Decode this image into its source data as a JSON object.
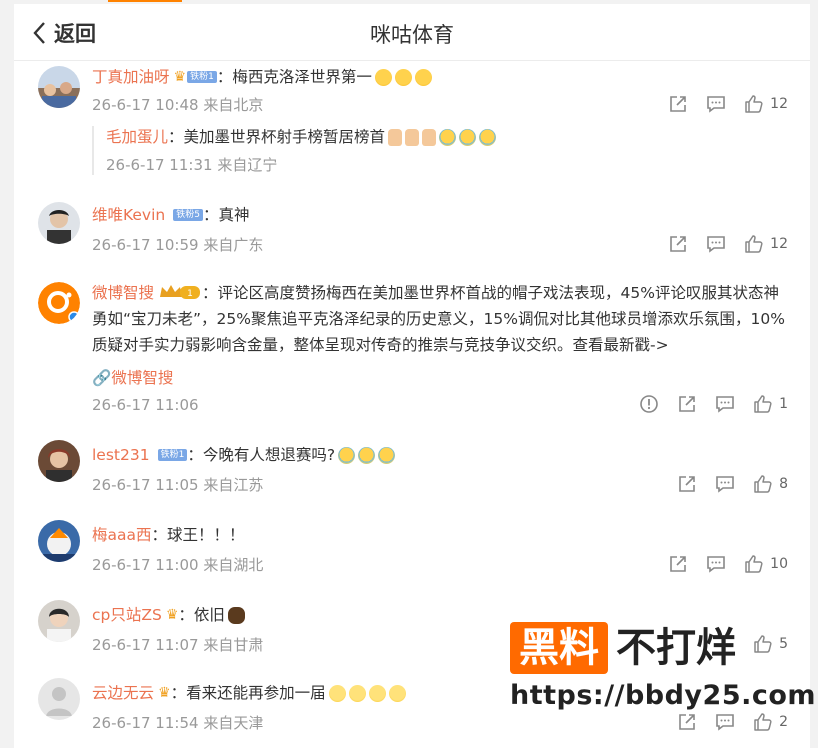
{
  "header": {
    "back_label": "返回",
    "title": "咪咕体育"
  },
  "comments": [
    {
      "user": "丁真加油呀",
      "fan_badge": "铁粉1",
      "text": "梅西克洛泽世界第一",
      "time": "26-6-17 10:48",
      "location": "来自北京",
      "likes": "12",
      "reply": {
        "user": "毛加蛋儿",
        "text": "美加墨世界杯射手榜暂居榜首",
        "time": "26-6-17 11:31",
        "location": "来自辽宁"
      }
    },
    {
      "user": "维唯Kevin",
      "fan_badge": "铁粉5",
      "text": "真神",
      "time": "26-6-17 10:59",
      "location": "来自广东",
      "likes": "12"
    },
    {
      "user": "微博智搜",
      "vip_level": "1",
      "text": "评论区高度赞扬梅西在美加墨世界杯首战的帽子戏法表现，45%评论叹服其状态神勇如“宝刀未老”，25%聚焦追平克洛泽纪录的历史意义，15%调侃对比其他球员增添欢乐氛围，10%质疑对手实力弱影响含金量，整体呈现对传奇的推崇与竞技争议交织。查看最新戳->",
      "link_label": "微博智搜",
      "time": "26-6-17 11:06",
      "likes": "1"
    },
    {
      "user": "lest231",
      "fan_badge": "铁粉1",
      "text": "今晚有人想退赛吗?",
      "time": "26-6-17 11:05",
      "location": "来自江苏",
      "likes": "8"
    },
    {
      "user": "梅aaa西",
      "text": "球王！！！",
      "time": "26-6-17 11:00",
      "location": "来自湖北",
      "likes": "10"
    },
    {
      "user": "cp只站ZS",
      "text": "依旧",
      "time": "26-6-17 11:07",
      "location": "来自甘肃",
      "likes": "5"
    },
    {
      "user": "云边无云",
      "text": "看来还能再参加一届",
      "time": "26-6-17 11:54",
      "location": "来自天津",
      "likes": "2"
    }
  ],
  "watermark": {
    "box_text": "黑料",
    "side_text": "不打烊",
    "url": "https://bbdy25.com"
  },
  "colors": {
    "username": "#eb7350",
    "meta": "#999999",
    "brand_orange": "#ff8200",
    "watermark_orange": "#ff6a00"
  },
  "icons": [
    "chevron-left-icon",
    "share-icon",
    "comment-icon",
    "like-icon",
    "report-icon",
    "link-icon",
    "crown-icon"
  ]
}
